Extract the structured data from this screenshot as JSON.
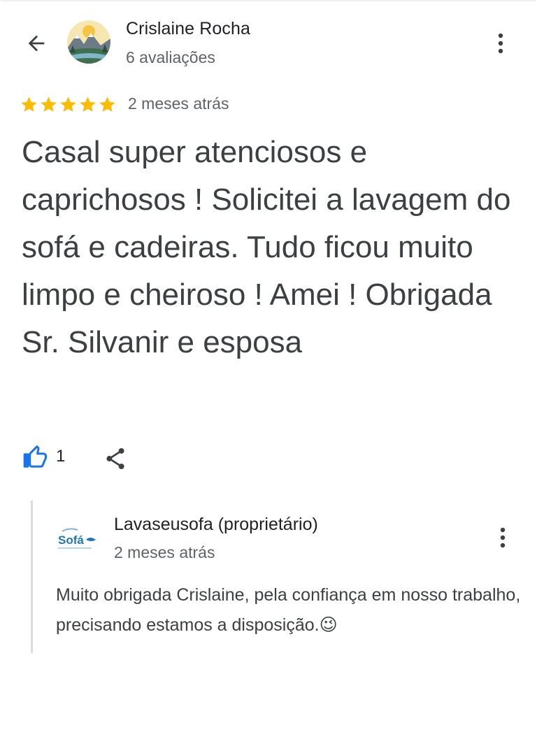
{
  "header": {
    "reviewer_name": "Crislaine Rocha",
    "review_count": "6 avaliações",
    "back_icon": "arrow-left-icon",
    "menu_icon": "more-vert-icon"
  },
  "review": {
    "rating": 5,
    "rating_max": 5,
    "star_color": "#fbbc04",
    "date": "2 meses atrás",
    "text": "Casal super atenciosos e caprichosos ! Solicitei a lavagem do sofá e cadeiras. Tudo ficou muito limpo e cheiroso ! Amei ! Obrigada Sr. Silvanir e esposa",
    "like_count": "1",
    "like_color": "#1a73e8"
  },
  "owner_reply": {
    "owner_name": "Lavaseusofa (proprietário)",
    "date": "2 meses atrás",
    "text": "Muito obrigada Crislaine, pela confiança em nosso trabalho, precisando estamos a disposição.",
    "emoji": "😉",
    "logo_text": "Sofá"
  }
}
